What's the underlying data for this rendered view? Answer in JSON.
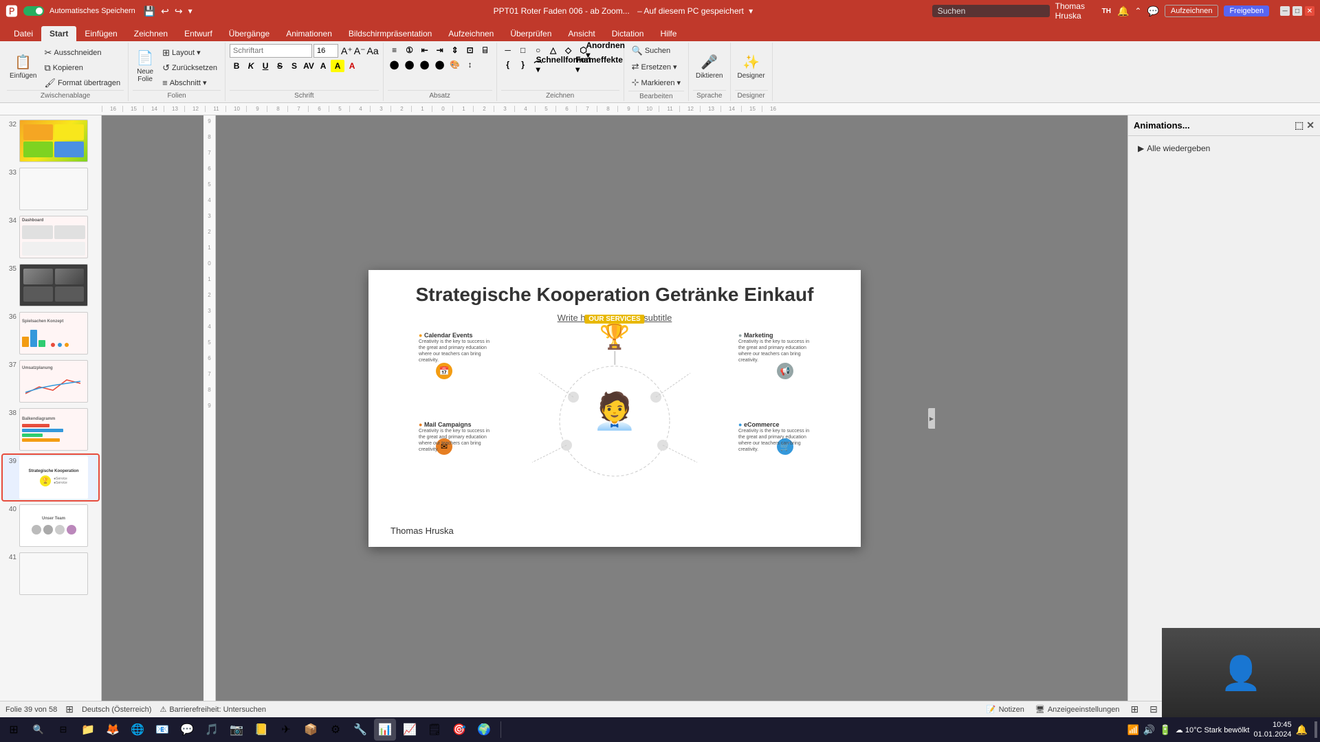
{
  "titlebar": {
    "autosave_label": "Automatisches Speichern",
    "filename": "PPT01 Roter Faden 006 - ab Zoom...",
    "save_location": "Auf diesem PC gespeichert",
    "user": "Thomas Hruska",
    "user_initials": "TH",
    "search_placeholder": "Suchen",
    "window_controls": [
      "─",
      "□",
      "✕"
    ]
  },
  "ribbon": {
    "tabs": [
      "Datei",
      "Start",
      "Einfügen",
      "Zeichnen",
      "Entwurf",
      "Übergänge",
      "Animationen",
      "Bildschirmpräsentation",
      "Aufzeichnen",
      "Überprüfen",
      "Ansicht",
      "Dictation",
      "Hilfe"
    ],
    "active_tab": "Start",
    "groups": {
      "zwischenablage": {
        "label": "Zwischenablage",
        "buttons": [
          "Einfügen",
          "Ausschneiden",
          "Kopieren",
          "Format übertragen"
        ]
      },
      "folien": {
        "label": "Folien",
        "buttons": [
          "Neue Folie",
          "Layout",
          "Zurücksetzen",
          "Abschnitt"
        ]
      },
      "schrift": {
        "label": "Schrift",
        "font": "",
        "size": "16",
        "bold": "B",
        "italic": "K",
        "underline": "U",
        "strikethrough": "S"
      },
      "absatz": {
        "label": "Absatz"
      },
      "zeichnen": {
        "label": "Zeichnen"
      },
      "bearbeiten": {
        "label": "Bearbeiten",
        "buttons": [
          "Suchen",
          "Ersetzen",
          "Markieren"
        ]
      },
      "sprache": {
        "label": "Sprache",
        "buttons": [
          "Diktieren",
          "Designer"
        ]
      },
      "designer": {
        "label": "Designer"
      }
    }
  },
  "slides": [
    {
      "num": 32,
      "type": "colorful",
      "active": false
    },
    {
      "num": 33,
      "type": "gray",
      "active": false
    },
    {
      "num": 34,
      "type": "has-chart",
      "label": "Dashboard",
      "active": false
    },
    {
      "num": 35,
      "type": "dark",
      "active": false
    },
    {
      "num": 36,
      "type": "has-chart",
      "label": "Spielsachen",
      "active": false
    },
    {
      "num": 37,
      "type": "has-chart",
      "label": "Umsatzplanung",
      "active": false
    },
    {
      "num": 38,
      "type": "has-chart",
      "label": "Balken",
      "active": false
    },
    {
      "num": 39,
      "type": "active-slide",
      "active": true
    },
    {
      "num": 40,
      "type": "team",
      "label": "Unser Team",
      "active": false
    },
    {
      "num": 41,
      "type": "gray",
      "active": false
    }
  ],
  "slide": {
    "title": "Strategische Kooperation Getränke Einkauf",
    "subtitle": "Write here your great subtitle",
    "footer": "Thomas Hruska",
    "trophy_label": "OUR SERVICES",
    "services": [
      {
        "name": "Calendar Events",
        "desc": "Creativity is the key to success in the great and primary education where our teachers can bring creativity.",
        "color": "orange",
        "position": "top-left"
      },
      {
        "name": "Marketing",
        "desc": "Creativity is the key to success in the great and primary education where our teachers can bring creativity.",
        "color": "gray",
        "position": "top-right"
      },
      {
        "name": "Mail Campaigns",
        "desc": "Creativity is the key to success in the great and primary education where our teachers can bring creativity.",
        "color": "orange",
        "position": "bottom-left"
      },
      {
        "name": "eCommerce",
        "desc": "Creativity is the key to success in the great and primary education where our teachers can bring creativity.",
        "color": "blue",
        "position": "bottom-right"
      }
    ]
  },
  "right_panel": {
    "title": "Animations...",
    "play_all_label": "Alle wiedergeben"
  },
  "statusbar": {
    "slide_info": "Folie 39 von 58",
    "language": "Deutsch (Österreich)",
    "accessibility": "Barrierefreiheit: Untersuchen",
    "notes": "Notizen",
    "slide_settings": "Anzeigeeinstellungen"
  },
  "taskbar": {
    "weather": "10°C  Stark bewölkt",
    "time": "...",
    "apps": [
      "⊞",
      "📁",
      "🌐",
      "🦊",
      "💻",
      "✉",
      "💬",
      "🎵",
      "📷",
      "📝",
      "🔔",
      "📊",
      "🎯",
      "🖊",
      "📧",
      "🗒",
      "📌",
      "🎨",
      "🌍",
      "📋",
      "📈"
    ]
  },
  "video_overlay": {
    "person": "👤"
  }
}
